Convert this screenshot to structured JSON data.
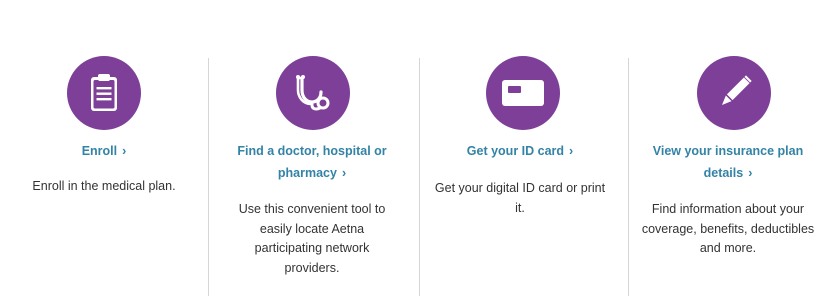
{
  "features": [
    {
      "icon": "clipboard-icon",
      "title": "Enroll",
      "chevron": "›",
      "description": "Enroll in the medical plan."
    },
    {
      "icon": "stethoscope-icon",
      "title": "Find a doctor, hospital or pharmacy",
      "chevron": "›",
      "description": "Use this convenient tool to easily locate Aetna participating network providers."
    },
    {
      "icon": "id-card-icon",
      "title": "Get your ID card",
      "chevron": "›",
      "description": "Get your digital ID card or print it."
    },
    {
      "icon": "pencil-icon",
      "title": "View your insurance plan details",
      "chevron": "›",
      "description": "Find information about your coverage, benefits, deductibles and more."
    }
  ],
  "colors": {
    "accent": "#7d3f98",
    "link": "#3283a6",
    "text": "#333333",
    "divider": "#d6d6d6"
  }
}
